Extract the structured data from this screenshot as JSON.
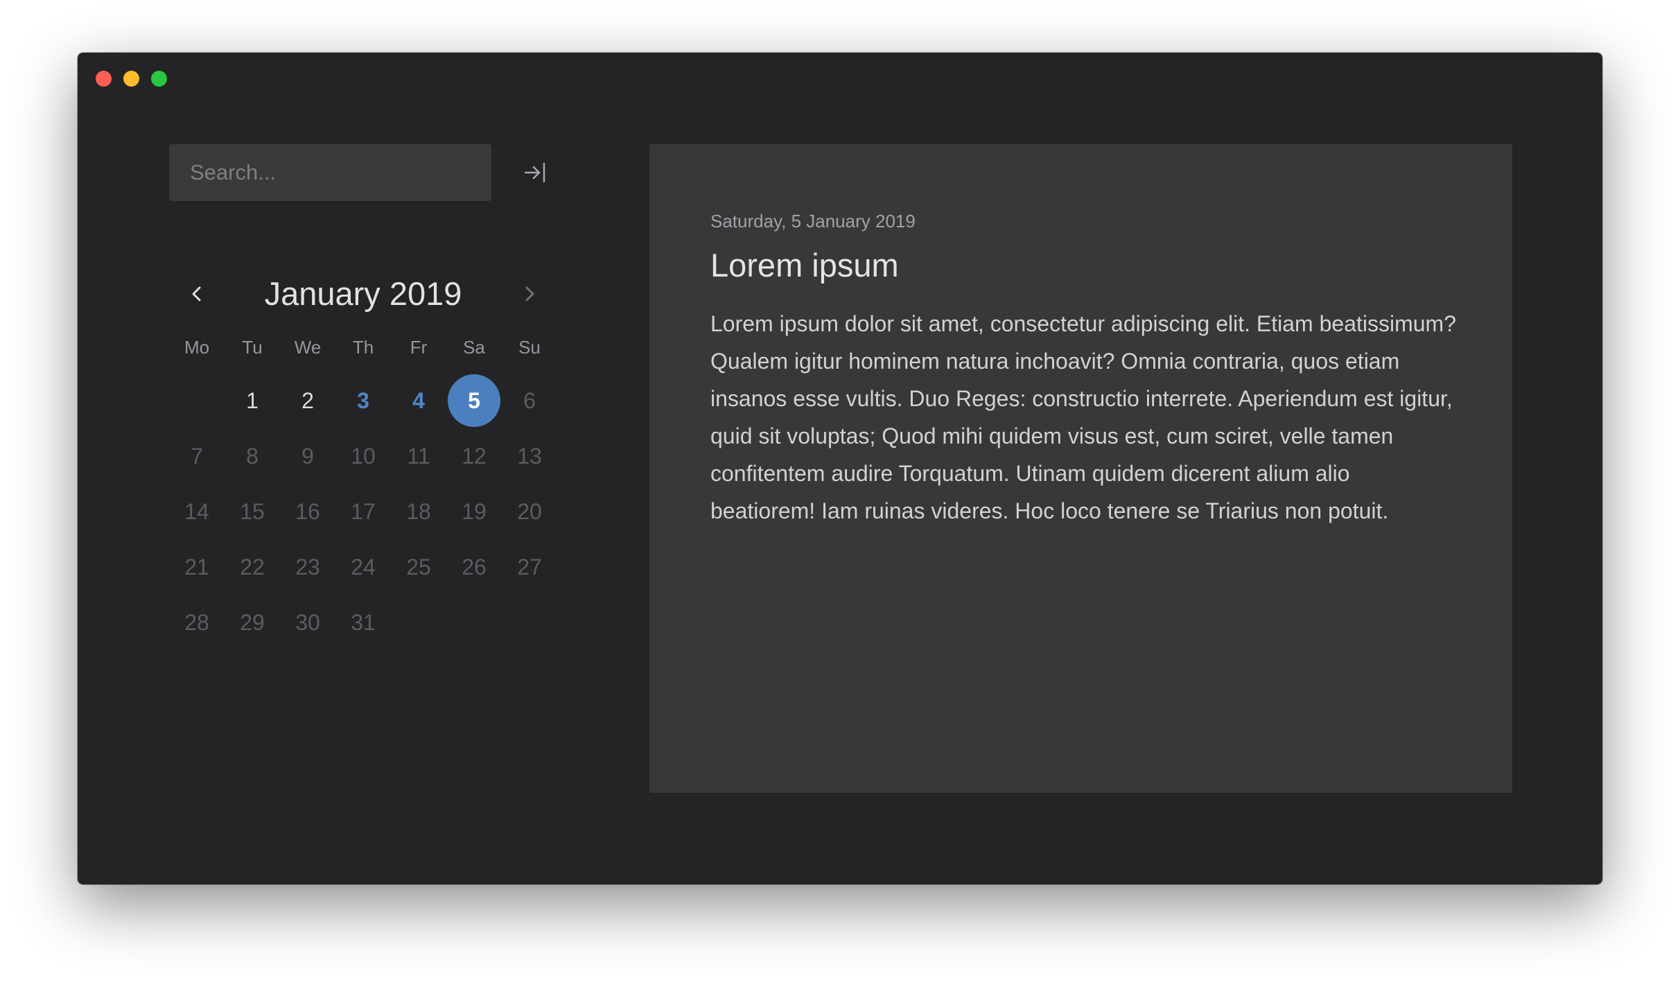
{
  "window": {
    "controls": [
      "close",
      "minimize",
      "maximize"
    ],
    "colors": {
      "close": "#fe5f57",
      "minimize": "#febc2e",
      "maximize": "#28c840"
    }
  },
  "sidebar": {
    "search": {
      "placeholder": "Search...",
      "value": ""
    },
    "collapse_icon": "arrow-right-to-bar-icon"
  },
  "calendar": {
    "month_title": "January 2019",
    "prev_icon": "chevron-left-icon",
    "next_icon": "chevron-right-icon",
    "weekdays": [
      "Mo",
      "Tu",
      "We",
      "Th",
      "Fr",
      "Sa",
      "Su"
    ],
    "days": [
      "",
      "1",
      "2",
      "3",
      "4",
      "5",
      "6",
      "7",
      "8",
      "9",
      "10",
      "11",
      "12",
      "13",
      "14",
      "15",
      "16",
      "17",
      "18",
      "19",
      "20",
      "21",
      "22",
      "23",
      "24",
      "25",
      "26",
      "27",
      "28",
      "29",
      "30",
      "31"
    ],
    "past_days": [
      "1",
      "2"
    ],
    "entry_days": [
      "3",
      "4"
    ],
    "selected_day": "5",
    "accent_color": "#4b7fbf"
  },
  "editor": {
    "date": "Saturday, 5 January 2019",
    "title": "Lorem ipsum",
    "body": "Lorem ipsum dolor sit amet, consectetur adipiscing elit. Etiam beatissimum? Qualem igitur hominem natura inchoavit? Omnia contraria, quos etiam insanos esse vultis. Duo Reges: constructio interrete. Aperiendum est igitur, quid sit voluptas; Quod mihi quidem visus est, cum sciret, velle tamen confitentem audire Torquatum. Utinam quidem dicerent alium alio beatiorem! Iam ruinas videres. Hoc loco tenere se Triarius non potuit."
  }
}
